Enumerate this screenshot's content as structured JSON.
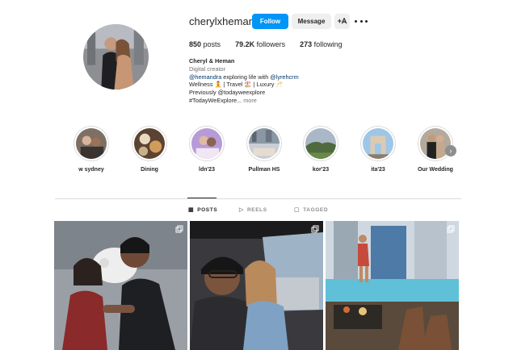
{
  "profile": {
    "username": "cherylxheman",
    "follow_label": "Follow",
    "message_label": "Message",
    "add_user_glyph": "+A",
    "posts_count": "850",
    "posts_label": "posts",
    "followers_count": "79.2K",
    "followers_label": "followers",
    "following_count": "273",
    "following_label": "following"
  },
  "bio": {
    "name": "Cheryl & Heman",
    "category": "Digital creator",
    "line1_mention1": "@hemandra",
    "line1_text": " exploring life with ",
    "line1_mention2": "@lyrehcrm",
    "line2": "Wellness 🧘 | Travel 🏖️ | Luxury 🥂",
    "line3": "Previously @todayweexplore",
    "line4": "#TodayWeExplore...",
    "more": " more"
  },
  "highlights": [
    {
      "label": "w sydney"
    },
    {
      "label": "Dining"
    },
    {
      "label": "ldn'23"
    },
    {
      "label": "Pullman HS"
    },
    {
      "label": "kor'23"
    },
    {
      "label": "ita'23"
    },
    {
      "label": "Our Wedding"
    }
  ],
  "tabs": {
    "posts": "POSTS",
    "reels": "REELS",
    "tagged": "TAGGED"
  },
  "colors": {
    "accent": "#0095f6",
    "link": "#00376b",
    "muted": "#737373"
  },
  "icons": {
    "posts_tab": "grid-icon",
    "reels_tab": "reels-icon",
    "tagged_tab": "tagged-icon",
    "multi_photo": "carousel-icon",
    "next": "chevron-right-icon"
  }
}
